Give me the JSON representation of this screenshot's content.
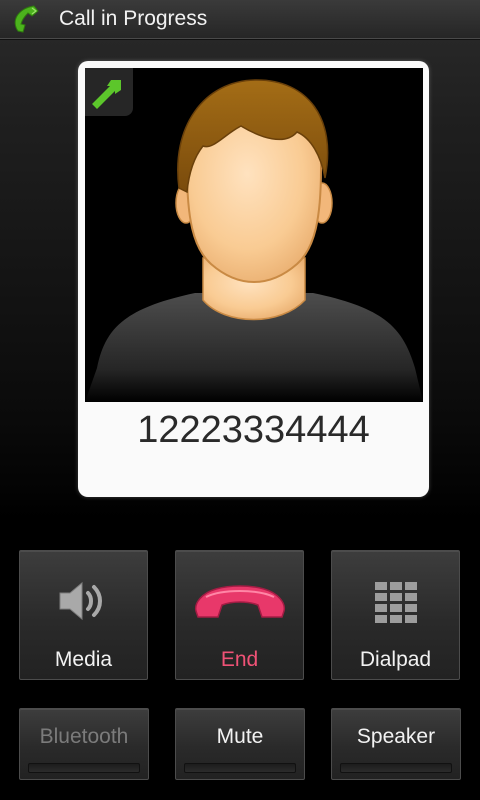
{
  "header": {
    "title": "Call in Progress"
  },
  "contact": {
    "number": "12223334444"
  },
  "buttons_row1": [
    {
      "id": "media",
      "label": "Media"
    },
    {
      "id": "end",
      "label": "End"
    },
    {
      "id": "dialpad",
      "label": "Dialpad"
    }
  ],
  "buttons_row2": [
    {
      "id": "bluetooth",
      "label": "Bluetooth",
      "state": "disabled"
    },
    {
      "id": "mute",
      "label": "Mute"
    },
    {
      "id": "speaker",
      "label": "Speaker"
    }
  ],
  "icons": {
    "title": "phone-icon",
    "expand": "expand-arrow-icon",
    "media": "speaker-volume-icon",
    "end": "end-call-icon",
    "dialpad": "dialpad-grid-icon"
  },
  "colors": {
    "end_accent": "#ef5276",
    "call_green": "#5cc62b",
    "title_bar": "#2f2f2f",
    "card_background": "#fafafa"
  }
}
